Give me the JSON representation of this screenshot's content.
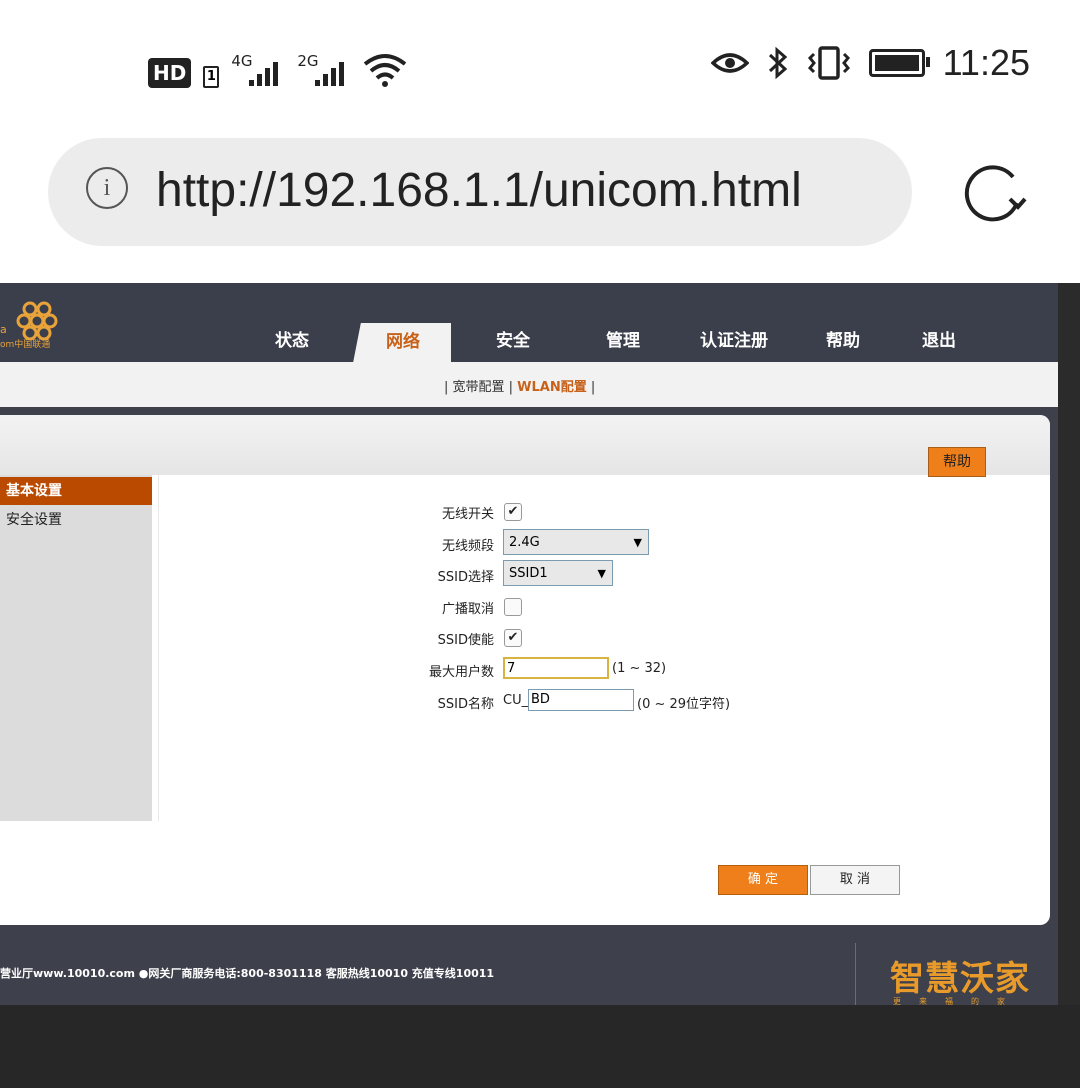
{
  "status_bar": {
    "hd": "HD",
    "sim": "1",
    "net1_label": "4G",
    "net2_label": "2G",
    "time": "11:25"
  },
  "browser": {
    "url": "http://192.168.1.1/unicom.html"
  },
  "router": {
    "logo_text_1": "a",
    "logo_text_2": "om中国联通",
    "nav": [
      "状态",
      "网络",
      "安全",
      "管理",
      "认证注册",
      "帮助",
      "退出"
    ],
    "active_nav": "网络",
    "subnav_prefix": "| 宽带配置 | ",
    "subnav_active": "WLAN配置",
    "subnav_suffix": " |",
    "help_label": "帮助",
    "sidebar": {
      "active": "基本设置",
      "items": [
        "安全设置"
      ]
    },
    "form": {
      "wireless_switch_label": "无线开关",
      "wireless_switch_checked": true,
      "band_label": "无线频段",
      "band_value": "2.4G",
      "ssid_select_label": "SSID选择",
      "ssid_select_value": "SSID1",
      "broadcast_cancel_label": "广播取消",
      "broadcast_cancel_checked": false,
      "ssid_enable_label": "SSID使能",
      "ssid_enable_checked": true,
      "max_users_label": "最大用户数",
      "max_users_value": "7",
      "max_users_hint": "(1 ~ 32)",
      "ssid_name_label": "SSID名称",
      "ssid_name_prefix": "CU_",
      "ssid_name_value": "BD",
      "ssid_name_hint": "(0 ~ 29位字符)"
    },
    "ok_label": "确 定",
    "cancel_label": "取 消",
    "footer": "营业厅www.10010.com ●网关厂商服务电话:800-8301118 客服热线10010 充值专线10011",
    "brand": "智慧沃家",
    "brand_sub": "更来福的家"
  },
  "colors": {
    "accent": "#ef7f1a",
    "active_sidebar": "#b94a00",
    "nav_bg": "#3b3e4b"
  }
}
